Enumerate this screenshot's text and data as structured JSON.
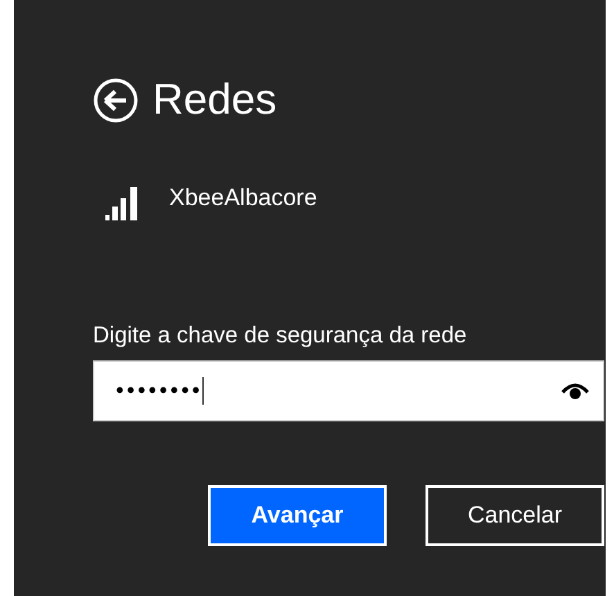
{
  "header": {
    "title": "Redes"
  },
  "network": {
    "name": "XbeeAlbacore"
  },
  "security_key": {
    "label": "Digite a chave de segurança da rede",
    "value": "••••••••"
  },
  "buttons": [
    {
      "label": "Avançar",
      "kind": "primary"
    },
    {
      "label": "Cancelar",
      "kind": "secondary"
    }
  ]
}
